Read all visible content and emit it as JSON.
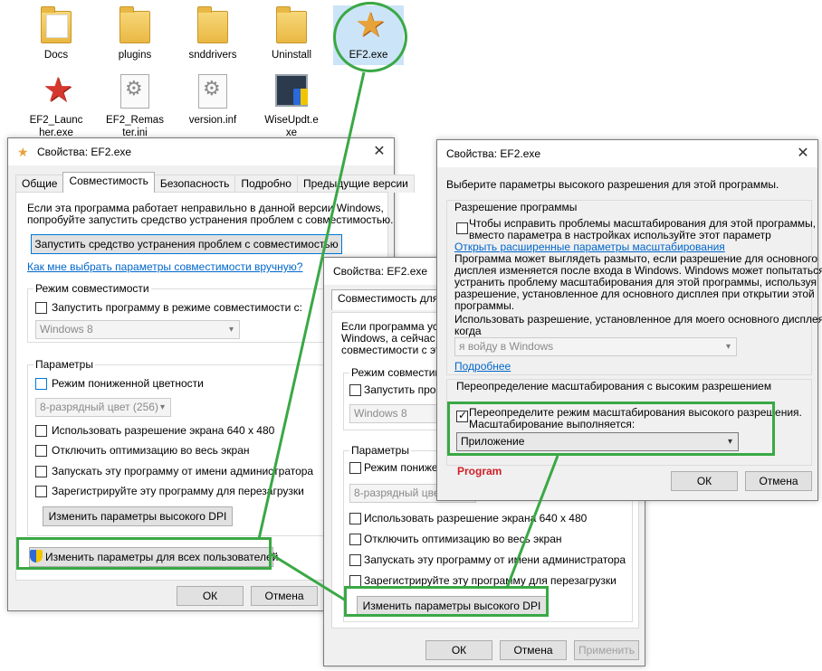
{
  "desktop": {
    "icons": [
      {
        "label": "Docs",
        "icon": "document-folder-icon"
      },
      {
        "label": "plugins",
        "icon": "folder-icon"
      },
      {
        "label": "snddrivers",
        "icon": "folder-icon"
      },
      {
        "label": "Uninstall",
        "icon": "folder-icon"
      },
      {
        "label": "EF2.exe",
        "icon": "star-app-icon"
      },
      {
        "label": "EF2_Launcher.exe",
        "icon": "launcher-app-icon"
      },
      {
        "label": "EF2_Remaster.ini",
        "icon": "settings-file-icon"
      },
      {
        "label": "version.inf",
        "icon": "settings-file-icon"
      },
      {
        "label": "WiseUpdt.exe",
        "icon": "installer-icon"
      }
    ],
    "labels_wrapped": {
      "launcher_1": "EF2_Launc",
      "launcher_2": "her.exe",
      "remaster_1": "EF2_Remas",
      "remaster_2": "ter.ini",
      "wise_1": "WiseUpdt.e",
      "wise_2": "xe"
    }
  },
  "dialog1": {
    "title": "Свойства: EF2.exe",
    "tabs": [
      "Общие",
      "Совместимость",
      "Безопасность",
      "Подробно",
      "Предыдущие версии"
    ],
    "intro_1": "Если эта программа работает неправильно в данной версии Windows,",
    "intro_2": "попробуйте запустить средство устранения проблем с совместимостью.",
    "troubleshoot_button": "Запустить средство устранения проблем с совместимостью",
    "manual_link": "Как мне выбрать параметры совместимости вручную?",
    "compat_group": "Режим совместимости",
    "compat_checkbox": "Запустить программу в режиме совместимости с:",
    "compat_select": "Windows 8",
    "params_group": "Параметры",
    "reduced_color": "Режим пониженной цветности",
    "color_select": "8-разрядный цвет (256)",
    "res640": "Использовать разрешение экрана 640 x 480",
    "fullscreen_opt": "Отключить оптимизацию во весь экран",
    "run_admin": "Запускать эту программу от имени администратора",
    "register_restart": "Зарегистрируйте эту программу для перезагрузки",
    "high_dpi_button": "Изменить параметры высокого DPI",
    "all_users_button": "Изменить параметры для всех пользователей",
    "ok": "ОК",
    "cancel": "Отмена"
  },
  "dialog2": {
    "title": "Свойства: EF2.exe",
    "tab_partial": "Совместимость для во",
    "intro_1": "Если программа успе",
    "intro_2": "Windows, а сейчас во",
    "intro_3": "совместимости с это",
    "compat_group": "Режим совместимо",
    "compat_checkbox": "Запустить прогр",
    "compat_select": "Windows 8",
    "params_group": "Параметры",
    "reduced_color": "Режим понижен",
    "color_select": "8-разрядный цвет",
    "res640": "Использовать разрешение экрана 640 x 480",
    "fullscreen_opt": "Отключить оптимизацию во весь экран",
    "run_admin": "Запускать эту программу от имени администратора",
    "register_restart": "Зарегистрируйте эту программу для перезагрузки",
    "high_dpi_button": "Изменить параметры высокого DPI",
    "ok": "ОК",
    "cancel": "Отмена",
    "apply": "Применить"
  },
  "dialog3": {
    "title": "Свойства: EF2.exe",
    "heading": "Выберите параметры высокого разрешения для этой программы.",
    "group1": "Разрешение программы",
    "cb1_line1": "Чтобы исправить проблемы масштабирования для этой программы,",
    "cb1_line2": "вместо параметра в настройках используйте этот параметр",
    "advanced_link": "Открыть расширенные параметры масштабирования",
    "body_1": "Программа может выглядеть размыто, если разрешение для основного",
    "body_2": "дисплея изменяется после входа в Windows. Windows может попытаться",
    "body_3": "устранить проблему масштабирования для этой программы, используя",
    "body_4": "разрешение, установленное для основного дисплея при открытии этой",
    "body_5": "программы.",
    "use_res_1": "Использовать разрешение, установленное для моего основного дисплея,",
    "use_res_2": "когда",
    "login_select": "я войду в Windows",
    "more_link": "Подробнее",
    "group2": "Переопределение масштабирования с высоким разрешением",
    "override_line1": "Переопределите режим масштабирования высокого разрешения.",
    "override_line2": "Масштабирование выполняется:",
    "scaling_select": "Приложение",
    "program_annotation": "Program",
    "ok": "ОК",
    "cancel": "Отмена"
  },
  "colors": {
    "highlight": "#3aa845",
    "link": "#0066cc",
    "annotation": "#d0202a"
  }
}
